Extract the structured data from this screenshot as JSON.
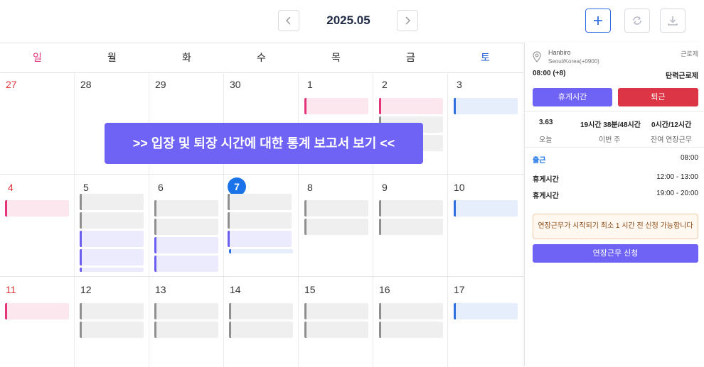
{
  "header": {
    "title": "2025.05",
    "prev_icon": "chevron-left-icon",
    "next_icon": "chevron-right-icon",
    "add_icon": "plus-icon",
    "refresh_icon": "refresh-icon",
    "download_icon": "download-icon"
  },
  "weekdays": [
    "일",
    "월",
    "화",
    "수",
    "목",
    "금",
    "토"
  ],
  "weeks": [
    [
      "27",
      "28",
      "29",
      "30",
      "1",
      "2",
      "3"
    ],
    [
      "4",
      "5",
      "6",
      "7",
      "8",
      "9",
      "10"
    ],
    [
      "11",
      "12",
      "13",
      "14",
      "15",
      "16",
      "17"
    ]
  ],
  "banner": ">> 입장 및 퇴장 시간에 대한 통계 보고서 보기 <<",
  "panel": {
    "location_icon": "location-pin-icon",
    "company": "Hanbiro",
    "timezone": "Seoul/Korea(+0900)",
    "role": "근로제",
    "start_time": "08:00 (+8)",
    "work_type": "탄력근로제",
    "break_button": "휴게시간",
    "leave_button": "퇴근",
    "stats": [
      {
        "value": "3.63",
        "label": "오늘"
      },
      {
        "value": "19시간 38분/48시간",
        "label": "이번 주"
      },
      {
        "value": "0시간/12시간",
        "label": "잔여 연장근무"
      }
    ],
    "checkin_label": "출근",
    "checkin_time": "08:00",
    "breaks": [
      {
        "label": "휴게시간",
        "time": "12:00 - 13:00"
      },
      {
        "label": "휴게시간",
        "time": "19:00 - 20:00"
      }
    ],
    "notice": "연장근무가 시작되기 최소 1 시간 전 신청 가능합니다",
    "overtime_button": "연장근무 신청"
  },
  "colors": {
    "accent": "#6f63f6",
    "danger": "#e0343c",
    "today": "#1a73e8",
    "sunday": "#e0343c",
    "saturday": "#1a5fd8"
  }
}
